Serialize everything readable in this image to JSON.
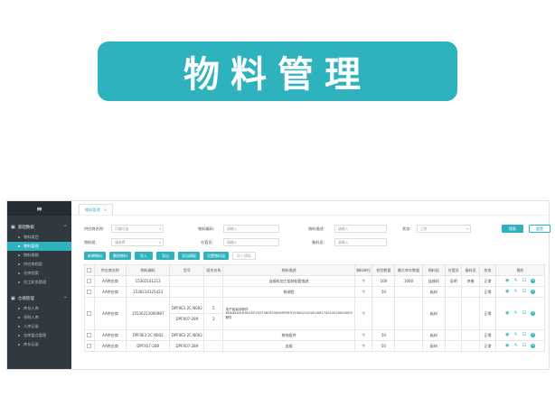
{
  "banner": {
    "title": "物料管理"
  },
  "sidebar": {
    "menu_icon": "≡",
    "groups": [
      {
        "label": "基础数据",
        "items": [
          "物料类目",
          "物料管理",
          "物料规格",
          "供应商档案",
          "仓库档案",
          "员工职务管理"
        ]
      },
      {
        "label": "仓储管理",
        "items": [
          "库存入库",
          "采购入库",
          "入库记录",
          "仓库盘点管理",
          "库存记录"
        ]
      }
    ],
    "active_item": "物料管理"
  },
  "tabs": [
    {
      "label": "物料管理",
      "close": "×"
    }
  ],
  "filters": {
    "supplier_label": "供应商名称:",
    "supplier_placeholder": "可输可选",
    "material_code_label": "物料编码:",
    "material_code_placeholder": "请输入",
    "material_desc_label": "物料描述:",
    "material_desc_placeholder": "请输入",
    "status_label": "状态:",
    "status_value": "正常",
    "category_label": "物料组:",
    "category_placeholder": "请选择",
    "keeper_label": "仓管员:",
    "keeper_placeholder": "请输入",
    "buyer_label": "备料员:",
    "buyer_placeholder": "请输入",
    "search_button": "搜索",
    "reset_button": "重置",
    "extra_button": "导入模板"
  },
  "toolbar": [
    "新增物料",
    "删除物料",
    "导入",
    "导出",
    "导出模板",
    "设置物料组"
  ],
  "table": {
    "headers": [
      "供应商名称",
      "物料编码",
      "型号",
      "组合关系",
      "物料描述",
      "物料单位",
      "检验数量",
      "最大库存数量",
      "物料组",
      "仓管员",
      "备料员",
      "状态",
      "操作"
    ],
    "rows": [
      {
        "supplier": "AA供应商",
        "code": "15302141213",
        "model": "",
        "relation": "",
        "desc": "连接机加工组装配套描述",
        "unit": "个",
        "qty": "100",
        "max": "1000",
        "group": "连接机",
        "keeper": "吴明",
        "buyer": "李勇",
        "status": "正常"
      },
      {
        "supplier": "AA供应商",
        "code": "15302141254​23",
        "model": "",
        "relation": "",
        "desc": "统调程",
        "unit": "个",
        "qty": "50",
        "max": "",
        "group": "板材",
        "keeper": "",
        "buyer": "",
        "status": "正常"
      },
      {
        "supplier": "AA供应商",
        "code": "15530213000987",
        "models": [
          "DPF0E3 2C N002",
          "DPFX07-289"
        ],
        "relations": [
          "5",
          "2"
        ],
        "desc": "电子组装线程件KEAD4U4UHIG1EEV32T560F2060HPS9HI1530021200016H174010020000005程件",
        "unit": "个",
        "qty": "",
        "max": "",
        "group": "板材",
        "keeper": "",
        "buyer": "",
        "status": "正常"
      },
      {
        "supplier": "AA供应商",
        "code": "DPF0E3 2C N002",
        "model": "DPF0E3 2C N002",
        "relation": "",
        "desc": "装饰组件",
        "unit": "个",
        "qty": "50",
        "max": "",
        "group": "板材",
        "keeper": "",
        "buyer": "",
        "status": "正常"
      },
      {
        "supplier": "AA供应商",
        "code": "DPFX07-289",
        "model": "DPFX07-289",
        "relation": "",
        "desc": "连接",
        "unit": "个",
        "qty": "50",
        "max": "",
        "group": "板材",
        "keeper": "",
        "buyer": "",
        "status": "正常"
      }
    ]
  },
  "icons": {
    "view": "eye-icon",
    "edit": "pencil-icon",
    "delete": "trash-icon",
    "more": "arrow-circle-icon"
  },
  "colors": {
    "accent": "#2eb2be",
    "sidebar": "#303840"
  }
}
